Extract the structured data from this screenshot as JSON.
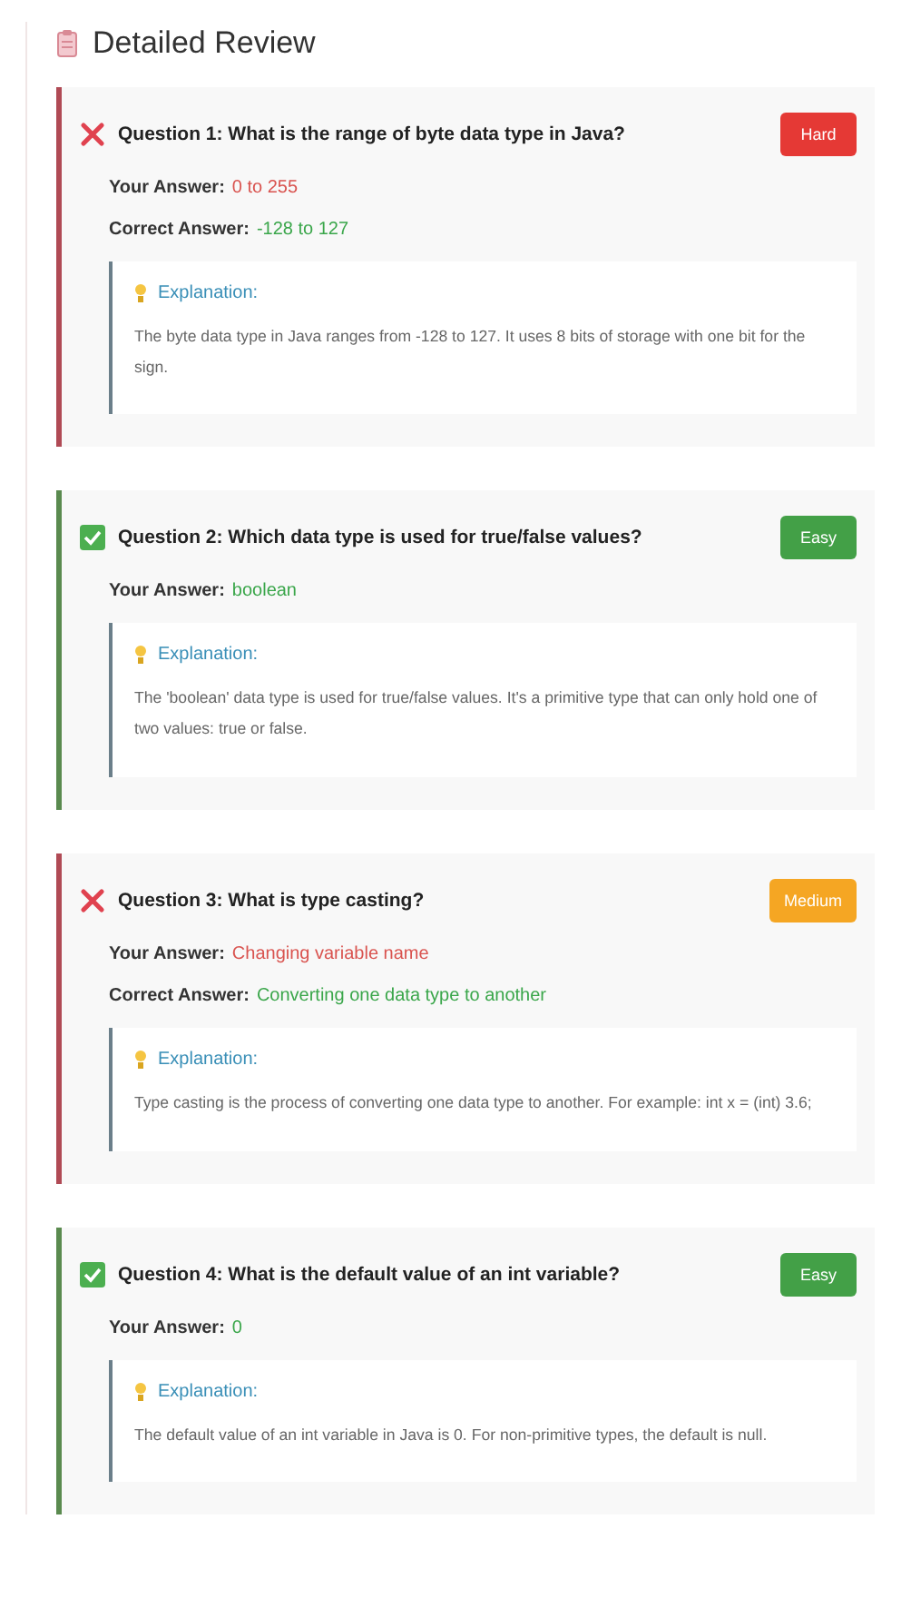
{
  "title": "Detailed Review",
  "questions": [
    {
      "correct": false,
      "question": "Question 1: What is the range of byte data type in Java?",
      "color": "#e53935",
      "badge": "Hard",
      "your_answer_label": "Your Answer:",
      "your_answer": "0 to 255",
      "correct_answer_label": "Correct Answer:",
      "correct_answer": "-128 to 127",
      "explanation_label": "Explanation:",
      "explanation": "The byte data type in Java ranges from -128 to 127. It uses 8 bits of storage with one bit for the sign."
    },
    {
      "correct": true,
      "question": "Question 2: Which data type is used for true/false values?",
      "color": "#43a047",
      "badge": "Easy",
      "your_answer_label": "Your Answer:",
      "your_answer": "boolean",
      "explanation_label": "Explanation:",
      "explanation": "The 'boolean' data type is used for true/false values. It's a primitive type that can only hold one of two values: true or false."
    },
    {
      "correct": false,
      "question": "Question 3: What is type casting?",
      "color": "#f5a623",
      "badge": "Medium",
      "your_answer_label": "Your Answer:",
      "your_answer": "Changing variable name",
      "correct_answer_label": "Correct Answer:",
      "correct_answer": "Converting one data type to another",
      "explanation_label": "Explanation:",
      "explanation": "Type casting is the process of converting one data type to another. For example: int x = (int) 3.6;"
    },
    {
      "correct": true,
      "question": "Question 4: What is the default value of an int variable?",
      "color": "#43a047",
      "badge": "Easy",
      "your_answer_label": "Your Answer:",
      "your_answer": "0",
      "explanation_label": "Explanation:",
      "explanation": "The default value of an int variable in Java is 0. For non-primitive types, the default is null."
    }
  ]
}
